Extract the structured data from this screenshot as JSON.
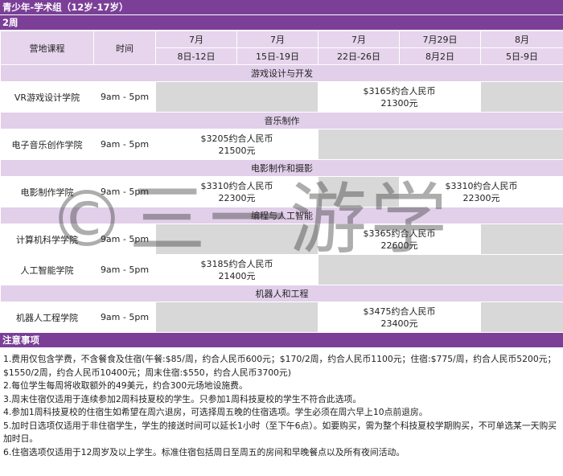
{
  "title": "青少年-学术组（12岁-17岁）",
  "subtitle": "2周",
  "header": {
    "col_course": "营地课程",
    "col_time": "时间",
    "sessions": [
      {
        "month": "7月",
        "dates": "8日-12日"
      },
      {
        "month": "7月",
        "dates": "15日-19日"
      },
      {
        "month": "7月",
        "dates": "22日-26日"
      },
      {
        "month": "7月29日",
        "dates": "8月2日"
      },
      {
        "month": "8月",
        "dates": "5日-9日"
      }
    ]
  },
  "categories": {
    "game": "游戏设计与开发",
    "music": "音乐制作",
    "film": "电影制作和摄影",
    "ai": "编程与人工智能",
    "robotics": "机器人和工程"
  },
  "courses": {
    "vr": {
      "name": "VR游戏设计学院",
      "time": "9am - 5pm",
      "price_usd": "$3165约合人民币",
      "price_rmb": "21300元"
    },
    "music": {
      "name": "电子音乐创作学院",
      "time": "9am - 5pm",
      "price_usd": "$3205约合人民币",
      "price_rmb": "21500元"
    },
    "film": {
      "name": "电影制作学院",
      "time": "9am - 5pm",
      "price_usd": "$3310约合人民币",
      "price_rmb": "22300元",
      "price_usd_2": "$3310约合人民币",
      "price_rmb_2": "22300元"
    },
    "cs": {
      "name": "计算机科学学院",
      "time": "9am - 5pm",
      "price_usd": "$3365约合人民币",
      "price_rmb": "22600元"
    },
    "ai": {
      "name": "人工智能学院",
      "time": "9am - 5pm",
      "price_usd": "$3185约合人民币",
      "price_rmb": "21400元"
    },
    "robot": {
      "name": "机器人工程学院",
      "time": "9am - 5pm",
      "price_usd": "$3475约合人民币",
      "price_rmb": "23400元"
    }
  },
  "notes": {
    "heading": "注意事项",
    "items": [
      "1.费用仅包含学费，不含餐食及住宿(午餐:$85/周，约合人民币600元；$170/2周，约合人民币1100元；住宿:$775/周，约合人民币5200元；$1550/2周，约合人民币10400元；周末住宿:$550，约合人民币3700元)",
      "2.每位学生每周将收取额外的49美元，约合300元场地设施费。",
      "3.周末住宿仅适用于连续参加2周科技夏校的学生。只参加1周科技夏校的学生不符合此选项。",
      "4.参加1周科技夏校的住宿生如希望在周六退房，可选择周五晚的住宿选项。学生必须在周六早上10点前退房。",
      "5.加时日选项仅适用于非住宿学生，学生的接送时间可以延长1小时（至下午6点）。如要购买，需为整个科技夏校学期购买，不可单选某一天购买加时日。",
      "6.住宿选项仅适用于12周岁及以上学生。标准住宿包括周日至周五的房间和早晚餐点以及所有夜间活动。"
    ]
  },
  "watermark": "©三一游学"
}
